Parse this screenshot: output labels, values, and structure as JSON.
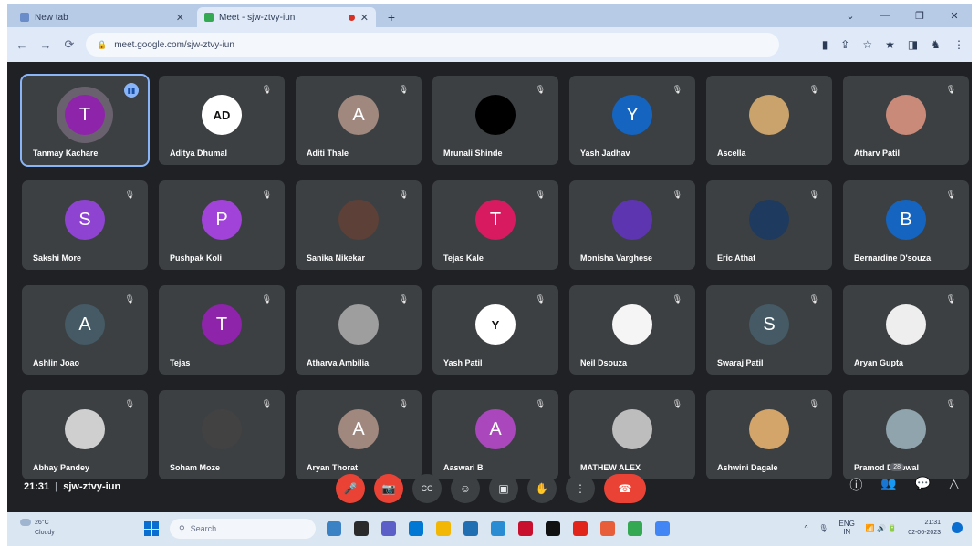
{
  "browser": {
    "tabs": [
      {
        "title": "New tab",
        "active": false
      },
      {
        "title": "Meet - sjw-ztvy-iun",
        "active": true
      }
    ],
    "new_tab": "+",
    "window_controls": [
      "⌄",
      "—",
      "❐",
      "✕"
    ],
    "nav": [
      "←",
      "→",
      "⟳"
    ],
    "url": "meet.google.com/sjw-ztvy-iun",
    "toolbar_icons": [
      "▮",
      "⇪",
      "☆",
      "★",
      "◨",
      "♞",
      "⋮"
    ]
  },
  "meeting": {
    "time": "21:31",
    "code": "sjw-ztvy-iun",
    "participant_count": "28",
    "participants": [
      {
        "name": "Tanmay Kachare",
        "initial": "T",
        "color": "#8e24aa",
        "type": "letter",
        "speaking": true
      },
      {
        "name": "Aditya Dhumal",
        "initial": "AD",
        "color": "#ffffff",
        "type": "photo"
      },
      {
        "name": "Aditi Thale",
        "initial": "A",
        "color": "#a1887f",
        "type": "letter"
      },
      {
        "name": "Mrunali Shinde",
        "initial": "",
        "color": "#000000",
        "type": "photo"
      },
      {
        "name": "Yash Jadhav",
        "initial": "Y",
        "color": "#1565c0",
        "type": "letter"
      },
      {
        "name": "Ascella",
        "initial": "",
        "color": "#c9a36b",
        "type": "photo"
      },
      {
        "name": "Atharv Patil",
        "initial": "",
        "color": "#c98a7a",
        "type": "photo"
      },
      {
        "name": "Sakshi More",
        "initial": "S",
        "color": "#8e44d1",
        "type": "letter"
      },
      {
        "name": "Pushpak Koli",
        "initial": "P",
        "color": "#a142d8",
        "type": "letter"
      },
      {
        "name": "Sanika Nikekar",
        "initial": "",
        "color": "#5d4037",
        "type": "photo"
      },
      {
        "name": "Tejas Kale",
        "initial": "T",
        "color": "#d81b60",
        "type": "letter"
      },
      {
        "name": "Monisha Varghese",
        "initial": "",
        "color": "#5e35b1",
        "type": "photo"
      },
      {
        "name": "Eric Athat",
        "initial": "",
        "color": "#1e3a5f",
        "type": "photo"
      },
      {
        "name": "Bernardine D'souza",
        "initial": "B",
        "color": "#1565c0",
        "type": "letter"
      },
      {
        "name": "Ashlin Joao",
        "initial": "A",
        "color": "#455a64",
        "type": "letter"
      },
      {
        "name": "Tejas",
        "initial": "T",
        "color": "#8e24aa",
        "type": "letter"
      },
      {
        "name": "Atharva Ambilia",
        "initial": "",
        "color": "#9e9e9e",
        "type": "photo"
      },
      {
        "name": "Yash Patil",
        "initial": "Y",
        "color": "#ffffff",
        "type": "photo"
      },
      {
        "name": "Neil Dsouza",
        "initial": "",
        "color": "#f5f5f5",
        "type": "photo"
      },
      {
        "name": "Swaraj Patil",
        "initial": "S",
        "color": "#455a64",
        "type": "letter"
      },
      {
        "name": "Aryan Gupta",
        "initial": "",
        "color": "#eeeeee",
        "type": "photo"
      },
      {
        "name": "Abhay Pandey",
        "initial": "",
        "color": "#cfcfcf",
        "type": "photo"
      },
      {
        "name": "Soham Moze",
        "initial": "",
        "color": "#424242",
        "type": "photo"
      },
      {
        "name": "Aryan Thorat",
        "initial": "A",
        "color": "#a1887f",
        "type": "letter"
      },
      {
        "name": "Aaswari B",
        "initial": "A",
        "color": "#ab47bc",
        "type": "letter"
      },
      {
        "name": "MATHEW ALEX",
        "initial": "",
        "color": "#bdbdbd",
        "type": "photo"
      },
      {
        "name": "Ashwini Dagale",
        "initial": "",
        "color": "#d4a56a",
        "type": "photo"
      },
      {
        "name": "Pramod Darbwal",
        "initial": "",
        "color": "#90a4ae",
        "type": "photo"
      }
    ],
    "controls": [
      "🎤",
      "📷",
      "CC",
      "☺",
      "▣",
      "✋",
      "⋮",
      "☎"
    ],
    "right_controls": [
      "ⓘ",
      "👥",
      "💬",
      "△"
    ]
  },
  "taskbar": {
    "weather_temp": "26°C",
    "weather_text": "Cloudy",
    "search_placeholder": "Search",
    "time": "21:31",
    "date": "02-06-2023",
    "lang": "ENG",
    "lang_sub": "IN",
    "apps": [
      {
        "color": "#3b82c4"
      },
      {
        "color": "#2b2b2b"
      },
      {
        "color": "#5b5fc7"
      },
      {
        "color": "#0078d4"
      },
      {
        "color": "#f2b705"
      },
      {
        "color": "#1f6fb2"
      },
      {
        "color": "#2a8dd4"
      },
      {
        "color": "#c8102e"
      },
      {
        "color": "#111111"
      },
      {
        "color": "#e1251b"
      },
      {
        "color": "#e85d3a"
      },
      {
        "color": "#34a853"
      },
      {
        "color": "#4285f4"
      }
    ]
  }
}
